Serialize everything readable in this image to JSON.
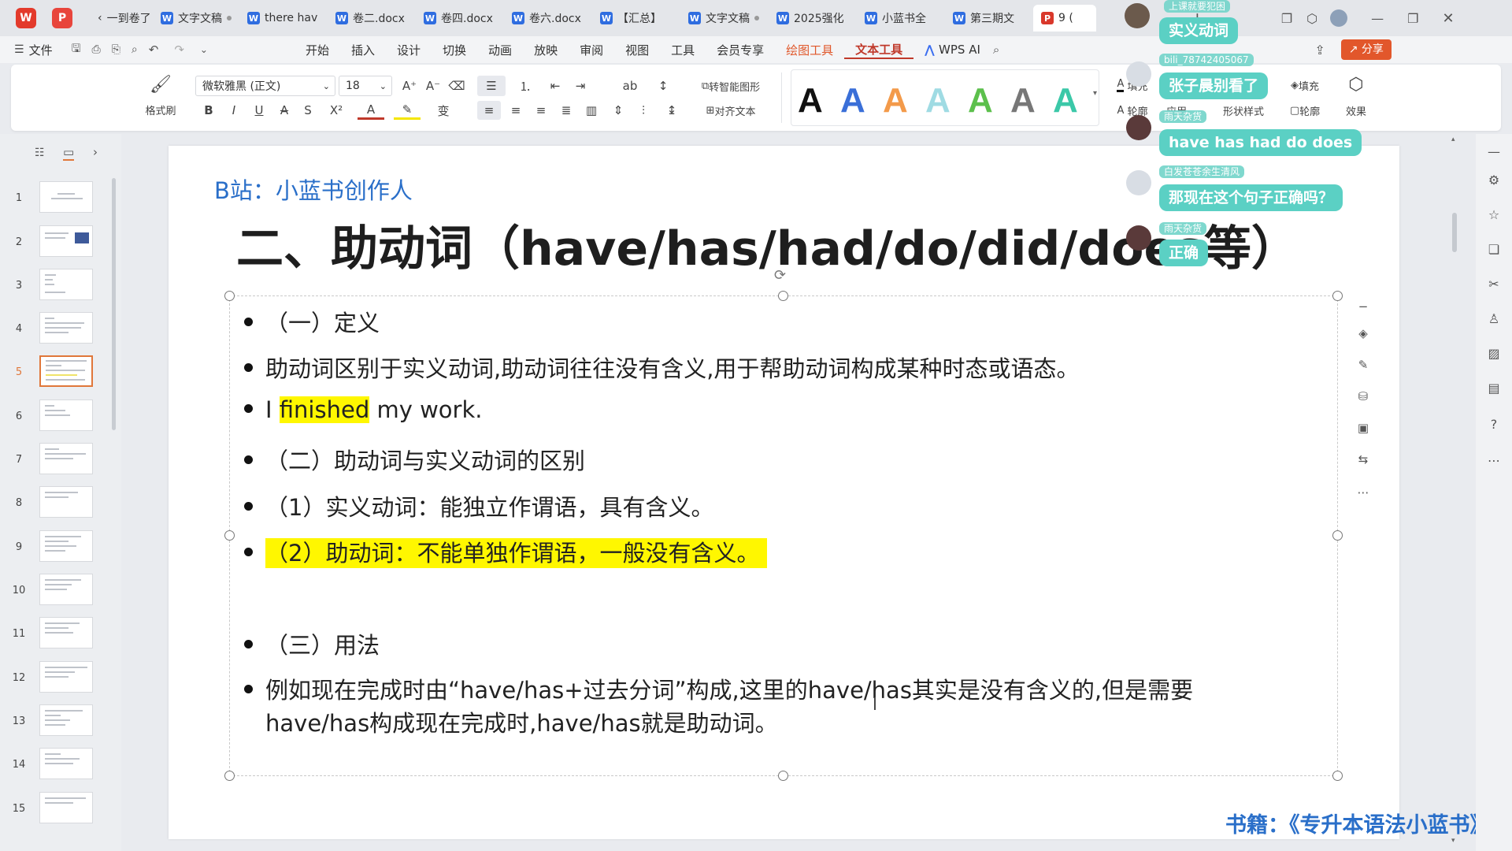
{
  "tabs": [
    {
      "label": "一到卷了",
      "icon": "w"
    },
    {
      "label": "文字文稿",
      "icon": "w"
    },
    {
      "label": "there hav",
      "icon": "w"
    },
    {
      "label": "卷二.docx",
      "icon": "w"
    },
    {
      "label": "卷四.docx",
      "icon": "w"
    },
    {
      "label": "卷六.docx",
      "icon": "w"
    },
    {
      "label": "【汇总】",
      "icon": "w"
    },
    {
      "label": "文字文稿",
      "icon": "w"
    },
    {
      "label": "2025强化",
      "icon": "w"
    },
    {
      "label": "小蓝书全",
      "icon": "w"
    },
    {
      "label": "第三期文",
      "icon": "w"
    },
    {
      "label": "9 (",
      "icon": "p"
    }
  ],
  "menubar": {
    "file": "文件",
    "items": [
      "开始",
      "插入",
      "设计",
      "切换",
      "动画",
      "放映",
      "审阅",
      "视图",
      "工具",
      "会员专享"
    ],
    "draw_tools": "绘图工具",
    "text_tools": "文本工具",
    "wps_ai": "WPS AI",
    "share": "分享"
  },
  "ribbon": {
    "format_painter": "格式刷",
    "font_name": "微软雅黑 (正文)",
    "font_size": "18",
    "smart_shape": "转智能图形",
    "align_text": "对齐文本",
    "fill": "填充",
    "outline": "轮廓",
    "shape_fill": "填充",
    "shape_outline": "轮廓",
    "shape_style": "形状样式",
    "effect": "效果",
    "apply": "应用",
    "font_styles": [
      {
        "letter": "A",
        "color": "#111111"
      },
      {
        "letter": "A",
        "color": "#3a6fd8"
      },
      {
        "letter": "A",
        "color": "#f39a4a"
      },
      {
        "letter": "A",
        "color": "#9fdbe3"
      },
      {
        "letter": "A",
        "color": "#5cc04c"
      },
      {
        "letter": "A",
        "color": "#777777"
      },
      {
        "letter": "A",
        "color": "#3bc8a8"
      }
    ]
  },
  "slides": [
    "1",
    "2",
    "3",
    "4",
    "5",
    "6",
    "7",
    "8",
    "9",
    "10",
    "11",
    "12",
    "13",
    "14",
    "15"
  ],
  "current_slide": "5",
  "slide": {
    "watermark": "B站：小蓝书创作人",
    "title": "二、助动词（have/has/had/do/did/does等）",
    "bullets": [
      "（一）定义",
      "助动词区别于实义动词,助动词往往没有含义,用于帮助动词构成某种时态或语态。",
      {
        "pre": "I ",
        "hl": "finished",
        "post": " my work."
      },
      "（二）助动词与实义动词的区别",
      "（1）实义动词：能独立作谓语，具有含义。",
      "（2）助动词：不能单独作谓语，一般没有含义。",
      "（三）用法",
      "例如现在完成时由“have/has+过去分词”构成,这里的have/has其实是没有含义的,但是需要",
      "have/has构成现在完成时,have/has就是助动词。"
    ],
    "book": "书籍：《专升本语法小蓝书》"
  },
  "danmaku": [
    {
      "user": "上课就要犯困",
      "text": "实义动词"
    },
    {
      "user": "bili_78742405067",
      "text": "张子晨别看了"
    },
    {
      "user": "雨天杂货",
      "text": "have has had do does"
    },
    {
      "user": "白发苍苍余生清风",
      "text": "那现在这个句子正确吗？"
    },
    {
      "user": "雨天杂货",
      "text": "正确"
    }
  ],
  "colors": {
    "accent": "#c0392b",
    "danmu": "#5bd0c4",
    "highlight": "#fff700",
    "title_blue": "#2a6fc9"
  }
}
